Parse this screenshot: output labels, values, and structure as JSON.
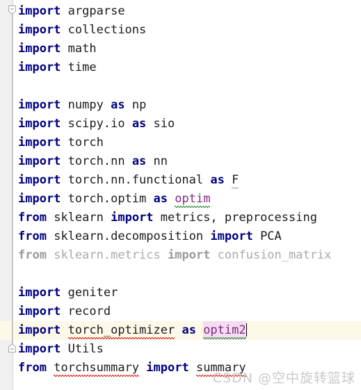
{
  "editor": {
    "language": "python",
    "font_size_px": 17,
    "line_height_px": 27,
    "colors": {
      "background": "#ffffff",
      "gutter_background": "#f0f0f0",
      "keyword": "#000080",
      "identifier": "#1a1a1a",
      "alias_highlight_text": "#7d2a7d",
      "dimmed_unused": "#a9a9a9",
      "current_line_background": "#fdf9e8",
      "identifier_occurrence_highlight": "#f6dcf2",
      "error_squiggle": "#e03a2f",
      "typo_squiggle": "#4a9a4a",
      "caret": "#000000"
    }
  },
  "gutter": {
    "fold_markers": [
      {
        "name": "fold-region-start",
        "state": "expanded",
        "line": 1
      },
      {
        "name": "fold-region-end",
        "state": "expanded",
        "line": 19
      }
    ]
  },
  "lines": [
    {
      "n": 1,
      "current": false,
      "tokens": [
        {
          "t": "import",
          "c": "kw"
        },
        {
          "t": " ",
          "c": "plain"
        },
        {
          "t": "argparse",
          "c": "plain"
        }
      ]
    },
    {
      "n": 2,
      "current": false,
      "tokens": [
        {
          "t": "import",
          "c": "kw"
        },
        {
          "t": " ",
          "c": "plain"
        },
        {
          "t": "collections",
          "c": "plain"
        }
      ]
    },
    {
      "n": 3,
      "current": false,
      "tokens": [
        {
          "t": "import",
          "c": "kw"
        },
        {
          "t": " ",
          "c": "plain"
        },
        {
          "t": "math",
          "c": "plain"
        }
      ]
    },
    {
      "n": 4,
      "current": false,
      "tokens": [
        {
          "t": "import",
          "c": "kw"
        },
        {
          "t": " ",
          "c": "plain"
        },
        {
          "t": "time",
          "c": "plain"
        }
      ]
    },
    {
      "n": 5,
      "current": false,
      "tokens": []
    },
    {
      "n": 6,
      "current": false,
      "tokens": [
        {
          "t": "import",
          "c": "kw"
        },
        {
          "t": " ",
          "c": "plain"
        },
        {
          "t": "numpy",
          "c": "plain"
        },
        {
          "t": " ",
          "c": "plain"
        },
        {
          "t": "as",
          "c": "kw"
        },
        {
          "t": " ",
          "c": "plain"
        },
        {
          "t": "np",
          "c": "plain"
        }
      ]
    },
    {
      "n": 7,
      "current": false,
      "tokens": [
        {
          "t": "import",
          "c": "kw"
        },
        {
          "t": " ",
          "c": "plain"
        },
        {
          "t": "scipy.io",
          "c": "plain"
        },
        {
          "t": " ",
          "c": "plain"
        },
        {
          "t": "as",
          "c": "kw"
        },
        {
          "t": " ",
          "c": "plain"
        },
        {
          "t": "sio",
          "c": "plain"
        }
      ]
    },
    {
      "n": 8,
      "current": false,
      "tokens": [
        {
          "t": "import",
          "c": "kw"
        },
        {
          "t": " ",
          "c": "plain"
        },
        {
          "t": "torch",
          "c": "plain"
        }
      ]
    },
    {
      "n": 9,
      "current": false,
      "tokens": [
        {
          "t": "import",
          "c": "kw"
        },
        {
          "t": " ",
          "c": "plain"
        },
        {
          "t": "torch.nn",
          "c": "plain"
        },
        {
          "t": " ",
          "c": "plain"
        },
        {
          "t": "as",
          "c": "kw"
        },
        {
          "t": " ",
          "c": "plain"
        },
        {
          "t": "nn",
          "c": "plain"
        }
      ]
    },
    {
      "n": 10,
      "current": false,
      "tokens": [
        {
          "t": "import",
          "c": "kw"
        },
        {
          "t": " ",
          "c": "plain"
        },
        {
          "t": "torch.nn.functional",
          "c": "plain"
        },
        {
          "t": " ",
          "c": "plain"
        },
        {
          "t": "as",
          "c": "kw"
        },
        {
          "t": " ",
          "c": "plain"
        },
        {
          "t": "F",
          "c": "plain",
          "squiggle": "grey"
        }
      ]
    },
    {
      "n": 11,
      "current": false,
      "tokens": [
        {
          "t": "import",
          "c": "kw"
        },
        {
          "t": " ",
          "c": "plain"
        },
        {
          "t": "torch.optim",
          "c": "plain"
        },
        {
          "t": " ",
          "c": "plain"
        },
        {
          "t": "as",
          "c": "kw"
        },
        {
          "t": " ",
          "c": "plain"
        },
        {
          "t": "optim",
          "c": "alias-purple",
          "squiggle": "green"
        }
      ]
    },
    {
      "n": 12,
      "current": false,
      "tokens": [
        {
          "t": "from",
          "c": "kw"
        },
        {
          "t": " ",
          "c": "plain"
        },
        {
          "t": "sklearn",
          "c": "plain"
        },
        {
          "t": " ",
          "c": "plain"
        },
        {
          "t": "import",
          "c": "kw"
        },
        {
          "t": " ",
          "c": "plain"
        },
        {
          "t": "metrics, preprocessing",
          "c": "plain"
        }
      ]
    },
    {
      "n": 13,
      "current": false,
      "tokens": [
        {
          "t": "from",
          "c": "kw"
        },
        {
          "t": " ",
          "c": "plain"
        },
        {
          "t": "sklearn.decomposition",
          "c": "plain"
        },
        {
          "t": " ",
          "c": "plain"
        },
        {
          "t": "import",
          "c": "kw"
        },
        {
          "t": " ",
          "c": "plain"
        },
        {
          "t": "PCA",
          "c": "plain"
        }
      ]
    },
    {
      "n": 14,
      "current": false,
      "tokens": [
        {
          "t": "from",
          "c": "dim-kw"
        },
        {
          "t": " ",
          "c": "dim"
        },
        {
          "t": "sklearn.metrics",
          "c": "dim"
        },
        {
          "t": " ",
          "c": "dim"
        },
        {
          "t": "import",
          "c": "dim-kw"
        },
        {
          "t": " ",
          "c": "dim"
        },
        {
          "t": "confusion_matrix",
          "c": "dim"
        }
      ]
    },
    {
      "n": 15,
      "current": false,
      "tokens": []
    },
    {
      "n": 16,
      "current": false,
      "tokens": [
        {
          "t": "import",
          "c": "kw"
        },
        {
          "t": " ",
          "c": "plain"
        },
        {
          "t": "geniter",
          "c": "plain"
        }
      ]
    },
    {
      "n": 17,
      "current": false,
      "tokens": [
        {
          "t": "import",
          "c": "kw"
        },
        {
          "t": " ",
          "c": "plain"
        },
        {
          "t": "record",
          "c": "plain"
        }
      ]
    },
    {
      "n": 18,
      "current": true,
      "tokens": [
        {
          "t": "import",
          "c": "kw"
        },
        {
          "t": " ",
          "c": "plain"
        },
        {
          "t": "torch_optimizer",
          "c": "plain",
          "squiggle": "red"
        },
        {
          "t": " ",
          "c": "plain"
        },
        {
          "t": "as",
          "c": "kw"
        },
        {
          "t": " ",
          "c": "plain"
        },
        {
          "t": "optim2",
          "c": "alias-purple",
          "squiggle": "green",
          "highlight": true,
          "caret_after": true
        }
      ]
    },
    {
      "n": 19,
      "current": false,
      "tokens": [
        {
          "t": "import",
          "c": "kw"
        },
        {
          "t": " ",
          "c": "plain"
        },
        {
          "t": "Utils",
          "c": "plain"
        }
      ]
    },
    {
      "n": 20,
      "current": false,
      "tokens": [
        {
          "t": "from",
          "c": "kw"
        },
        {
          "t": " ",
          "c": "plain"
        },
        {
          "t": "torchsummary",
          "c": "plain",
          "squiggle": "red"
        },
        {
          "t": " ",
          "c": "plain"
        },
        {
          "t": "import",
          "c": "kw"
        },
        {
          "t": " ",
          "c": "plain"
        },
        {
          "t": "summary",
          "c": "plain",
          "squiggle": "red"
        }
      ]
    }
  ],
  "watermark": {
    "text": "CSDN @空中旋转篮球"
  }
}
